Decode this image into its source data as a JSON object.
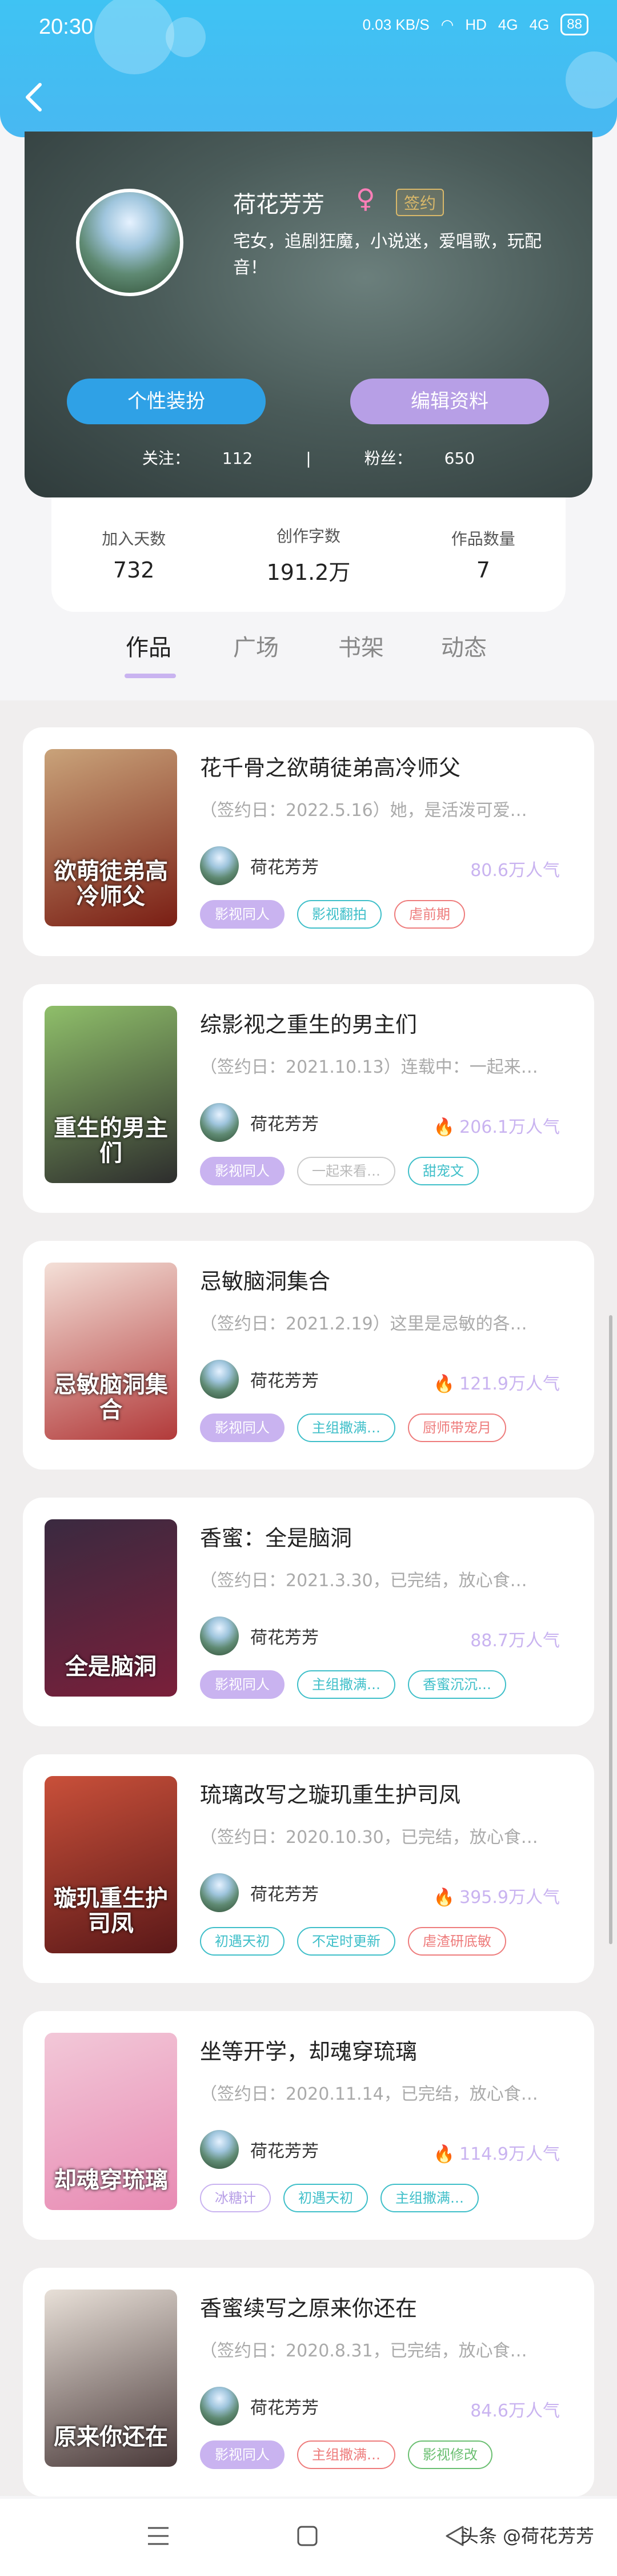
{
  "status_bar": {
    "time": "20:30",
    "net_speed": "0.03 KB/S",
    "hd": "HD",
    "signal1": "4G",
    "signal2": "4G",
    "battery": "88"
  },
  "profile": {
    "name": "荷花芳芳",
    "gender_symbol": "♀",
    "signed_label": "签约",
    "bio": "宅女，追剧狂魔，小说迷，爱唱歌，玩配音！",
    "dress_button": "个性装扮",
    "edit_button": "编辑资料",
    "follow_label": "关注：",
    "follow_count": "112",
    "fans_label": "粉丝：",
    "fans_count": "650",
    "separator": "|"
  },
  "stats": [
    {
      "label": "加入天数",
      "value": "732"
    },
    {
      "label": "创作字数",
      "value": "191.2万"
    },
    {
      "label": "作品数量",
      "value": "7"
    }
  ],
  "tabs": [
    {
      "label": "作品",
      "active": true
    },
    {
      "label": "广场",
      "active": false
    },
    {
      "label": "书架",
      "active": false
    },
    {
      "label": "动态",
      "active": false
    }
  ],
  "works": [
    {
      "title": "花千骨之欲萌徒弟高冷师父",
      "desc": "（签约日：2022.5.16）她，是活泼可爱…",
      "author": "荷花芳芳",
      "popularity": "80.6万人气",
      "hot": false,
      "cover_text": "欲萌徒弟高冷师父",
      "cover_colors": [
        "#c9a37a",
        "#7a1e14"
      ],
      "tags": [
        {
          "text": "影视同人",
          "style": "purple"
        },
        {
          "text": "影视翻拍",
          "style": "cyan"
        },
        {
          "text": "虐前期",
          "style": "red"
        }
      ]
    },
    {
      "title": "综影视之重生的男主们",
      "desc": "（签约日：2021.10.13）连载中：一起来…",
      "author": "荷花芳芳",
      "popularity": "206.1万人气",
      "hot": true,
      "cover_text": "重生的男主们",
      "cover_colors": [
        "#8fbf6a",
        "#2d2d2d"
      ],
      "tags": [
        {
          "text": "影视同人",
          "style": "purple"
        },
        {
          "text": "一起来看…",
          "style": "gray"
        },
        {
          "text": "甜宠文",
          "style": "cyan"
        }
      ]
    },
    {
      "title": "忌敏脑洞集合",
      "desc": "（签约日：2021.2.19）这里是忌敏的各…",
      "author": "荷花芳芳",
      "popularity": "121.9万人气",
      "hot": true,
      "cover_text": "忌敏脑洞集合",
      "cover_colors": [
        "#f4e0d8",
        "#b23a3a"
      ],
      "tags": [
        {
          "text": "影视同人",
          "style": "purple"
        },
        {
          "text": "主组撒满…",
          "style": "cyan"
        },
        {
          "text": "厨师带宠月",
          "style": "red"
        }
      ]
    },
    {
      "title": "香蜜：全是脑洞",
      "desc": "（签约日：2021.3.30，已完结，放心食…",
      "author": "荷花芳芳",
      "popularity": "88.7万人气",
      "hot": false,
      "cover_text": "全是脑洞",
      "cover_colors": [
        "#3a2a40",
        "#7a1f3a"
      ],
      "tags": [
        {
          "text": "影视同人",
          "style": "purple"
        },
        {
          "text": "主组撒满…",
          "style": "cyan"
        },
        {
          "text": "香蜜沉沉…",
          "style": "cyan"
        }
      ]
    },
    {
      "title": "琉璃改写之璇玑重生护司凤",
      "desc": "（签约日：2020.10.30，已完结，放心食…",
      "author": "荷花芳芳",
      "popularity": "395.9万人气",
      "hot": true,
      "cover_text": "璇玑重生护司凤",
      "cover_colors": [
        "#c9503a",
        "#5a1818"
      ],
      "tags": [
        {
          "text": "初遇天初",
          "style": "cyan"
        },
        {
          "text": "不定时更新",
          "style": "cyan"
        },
        {
          "text": "虐渣研底敏",
          "style": "red"
        }
      ]
    },
    {
      "title": "坐等开学，却魂穿琉璃",
      "desc": "（签约日：2020.11.14，已完结，放心食…",
      "author": "荷花芳芳",
      "popularity": "114.9万人气",
      "hot": true,
      "cover_text": "却魂穿琉璃",
      "cover_colors": [
        "#f2c8d8",
        "#e88ab3"
      ],
      "tags": [
        {
          "text": "冰糖计",
          "style": "lav"
        },
        {
          "text": "初遇天初",
          "style": "cyan"
        },
        {
          "text": "主组撒满…",
          "style": "cyan"
        }
      ]
    },
    {
      "title": "香蜜续写之原来你还在",
      "desc": "（签约日：2020.8.31，已完结，放心食…",
      "author": "荷花芳芳",
      "popularity": "84.6万人气",
      "hot": false,
      "cover_text": "原来你还在",
      "cover_colors": [
        "#e8e0d8",
        "#4a3a3a"
      ],
      "tags": [
        {
          "text": "影视同人",
          "style": "purple"
        },
        {
          "text": "主组撒满…",
          "style": "red"
        },
        {
          "text": "影视修改",
          "style": "green"
        }
      ]
    }
  ],
  "watermark": "头条 @荷花芳芳"
}
